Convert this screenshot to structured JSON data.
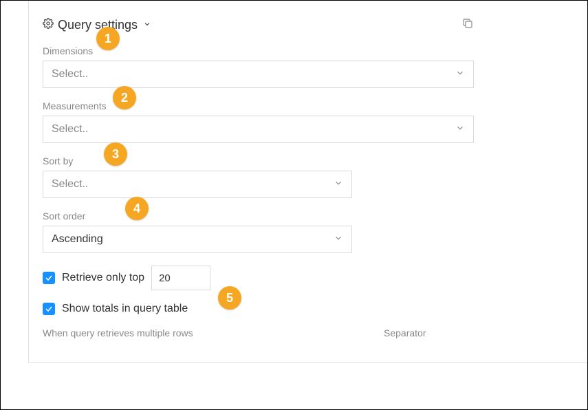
{
  "header": {
    "title": "Query settings"
  },
  "fields": {
    "dimensions": {
      "label": "Dimensions",
      "placeholder": "Select.."
    },
    "measurements": {
      "label": "Measurements",
      "placeholder": "Select.."
    },
    "sortBy": {
      "label": "Sort by",
      "placeholder": "Select.."
    },
    "sortOrder": {
      "label": "Sort order",
      "value": "Ascending"
    },
    "retrieveTop": {
      "label": "Retrieve only top",
      "value": "20"
    },
    "showTotals": {
      "label": "Show totals in query table"
    },
    "multiRows": {
      "label": "When query retrieves multiple rows"
    },
    "separator": {
      "label": "Separator"
    }
  },
  "markers": {
    "m1": "1",
    "m2": "2",
    "m3": "3",
    "m4": "4",
    "m5": "5"
  }
}
